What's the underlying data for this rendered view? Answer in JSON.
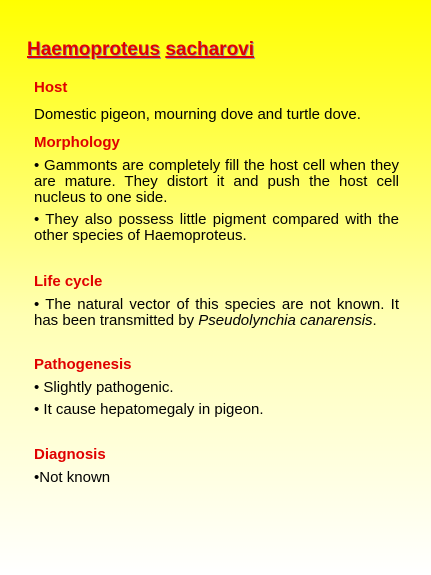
{
  "title": {
    "genus": "Haemoproteus",
    "species": "sacharovi"
  },
  "sections": {
    "host": {
      "heading": "Host",
      "text": "Domestic pigeon, mourning dove and turtle dove."
    },
    "morphology": {
      "heading": "Morphology",
      "points": [
        "• Gammonts are completely fill the host cell when they are mature. They distort it and push the host cell nucleus to one side.",
        "• They also possess little pigment compared with the other species of Haemoproteus."
      ]
    },
    "life_cycle": {
      "heading": "Life cycle",
      "text_before": "• The natural vector of this species are not known. It has been transmitted by ",
      "vector_name": "Pseudolynchia canarensis",
      "text_after": "."
    },
    "pathogenesis": {
      "heading": "Pathogenesis",
      "points": [
        "• Slightly pathogenic.",
        "• It cause hepatomegaly in pigeon."
      ]
    },
    "diagnosis": {
      "heading": "Diagnosis",
      "text": "•Not known"
    }
  }
}
